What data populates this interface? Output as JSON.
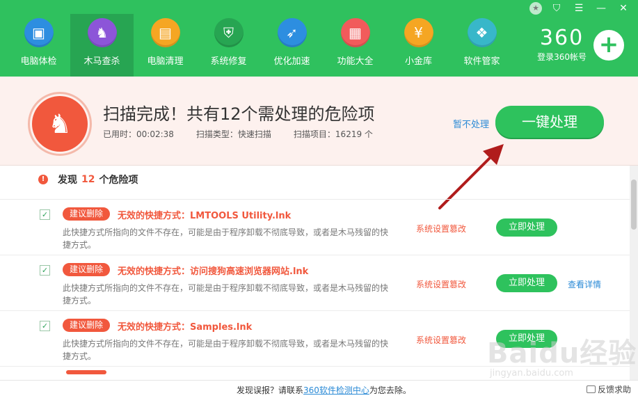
{
  "window": {
    "skin_icon": "star-icon",
    "shirt_icon": "shirt-icon",
    "minimize": "—",
    "close": "✕"
  },
  "nav": [
    {
      "label": "电脑体检",
      "icon": "monitor-icon",
      "color": "#2d8ee0",
      "glyph": "▣"
    },
    {
      "label": "木马查杀",
      "icon": "horse-icon",
      "color": "#8c55d8",
      "glyph": "♞",
      "active": true
    },
    {
      "label": "电脑清理",
      "icon": "broom-icon",
      "color": "#f5a623",
      "glyph": "▤"
    },
    {
      "label": "系统修复",
      "icon": "shield-icon",
      "color": "#27a552",
      "glyph": "⛨"
    },
    {
      "label": "优化加速",
      "icon": "rocket-icon",
      "color": "#2d8ee0",
      "glyph": "➶"
    },
    {
      "label": "功能大全",
      "icon": "apps-icon",
      "color": "#f15b5b",
      "glyph": "▦"
    },
    {
      "label": "小金库",
      "icon": "coin-icon",
      "color": "#f5a623",
      "glyph": "¥"
    },
    {
      "label": "软件管家",
      "icon": "software-icon",
      "color": "#38b7c9",
      "glyph": "❖"
    }
  ],
  "brand": {
    "logo": "360",
    "login": "登录360帐号",
    "plus": "+"
  },
  "banner": {
    "title": "扫描完成！共有12个需处理的危险项",
    "elapsed": "已用时：00:02:38",
    "scan_type": "扫描类型：快速扫描",
    "scan_items": "扫描项目：16219 个",
    "skip": "暂不处理",
    "fix_all": "一键处理"
  },
  "list": {
    "prefix": "发现",
    "count": "12",
    "suffix": "个危险项",
    "items": [
      {
        "tag": "建议删除",
        "title": "无效的快捷方式：LMTOOLS Utility.lnk",
        "desc": "此快捷方式所指向的文件不存在，可能是由于程序卸载不彻底导致，或者是木马残留的快捷方式。",
        "category": "系统设置篡改",
        "action": "立即处理",
        "detail": ""
      },
      {
        "tag": "建议删除",
        "title": "无效的快捷方式：访问搜狗高速浏览器网站.lnk",
        "desc": "此快捷方式所指向的文件不存在，可能是由于程序卸载不彻底导致，或者是木马残留的快捷方式。",
        "category": "系统设置篡改",
        "action": "立即处理",
        "detail": "查看详情"
      },
      {
        "tag": "建议删除",
        "title": "无效的快捷方式：Samples.lnk",
        "desc": "此快捷方式所指向的文件不存在，可能是由于程序卸载不彻底导致，或者是木马残留的快捷方式。",
        "category": "系统设置篡改",
        "action": "立即处理",
        "detail": ""
      }
    ]
  },
  "footer": {
    "text_before": "发现误报？请联系",
    "link": "360软件检测中心",
    "text_after": "为您去除。",
    "feedback": "反馈求助"
  },
  "watermark": {
    "logo": "Baidu经验",
    "sub": "jingyan.baidu.com"
  },
  "colors": {
    "accent_green": "#2fc15e",
    "danger": "#f1583d",
    "link": "#2a8ad6"
  }
}
